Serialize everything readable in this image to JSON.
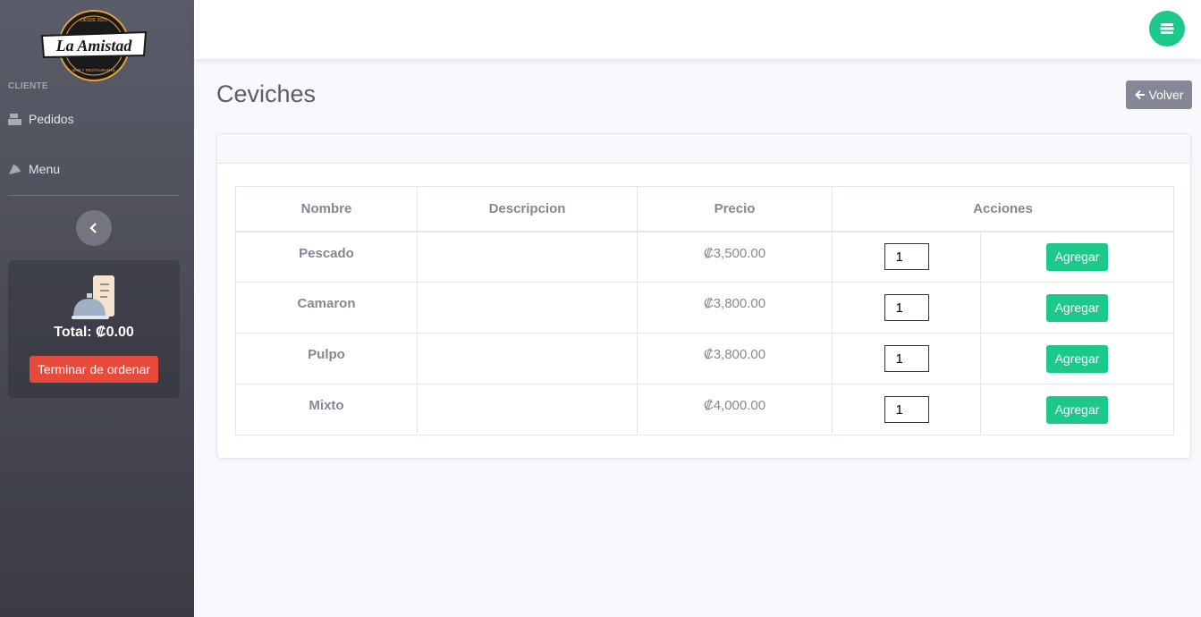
{
  "sidebar": {
    "logo_text": "La Amistad",
    "logo_top_text": "DESDE 2020",
    "logo_bottom_text": "BAR Y RESTAURANTE",
    "heading": "CLIENTE",
    "items": [
      {
        "label": "Pedidos",
        "icon": "register-icon"
      },
      {
        "label": "Menu",
        "icon": "pizza-icon"
      }
    ],
    "toggle_icon": "chevron-left-icon",
    "cart": {
      "icon": "service-bell-receipt-icon",
      "total": "Total: ₡0.00",
      "button_label": "Terminar de ordenar"
    }
  },
  "topbar": {
    "user_icon": "user-menu-icon"
  },
  "main": {
    "title": "Ceviches",
    "back_label": "Volver",
    "table": {
      "headers": [
        "Nombre",
        "Descripcion",
        "Precio",
        "Acciones"
      ],
      "rows": [
        {
          "nombre": "Pescado",
          "descripcion": "",
          "precio": "₡3,500.00",
          "qty": "1",
          "action": "Agregar"
        },
        {
          "nombre": "Camaron",
          "descripcion": "",
          "precio": "₡3,800.00",
          "qty": "1",
          "action": "Agregar"
        },
        {
          "nombre": "Pulpo",
          "descripcion": "",
          "precio": "₡3,800.00",
          "qty": "1",
          "action": "Agregar"
        },
        {
          "nombre": "Mixto",
          "descripcion": "",
          "precio": "₡4,000.00",
          "qty": "1",
          "action": "Agregar"
        }
      ]
    }
  },
  "colors": {
    "sidebar_top": "#5a5c69",
    "sidebar_bottom": "#3a3b45",
    "success": "#1cc88a",
    "danger": "#e74a3b",
    "secondary": "#858796"
  }
}
